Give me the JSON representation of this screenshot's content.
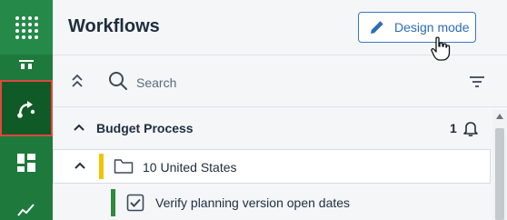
{
  "app": {
    "title": "Workflows",
    "accent_color": "#1e7a3c",
    "active_marker_color": "#e0473e"
  },
  "rail": {
    "items": [
      {
        "icon": "app-grid-icon"
      },
      {
        "icon": "rail-item-icon"
      },
      {
        "icon": "workflow-icon",
        "active": true
      },
      {
        "icon": "dashboard-icon"
      },
      {
        "icon": "analytics-icon"
      }
    ]
  },
  "header": {
    "design_mode_label": "Design mode",
    "design_mode_icon": "pencil-icon"
  },
  "toolbar": {
    "collapse_icon": "collapse-all-icon",
    "search_placeholder": "Search",
    "filter_icon": "filter-icon"
  },
  "group": {
    "title": "Budget Process",
    "notification_count": "1",
    "expanded": true
  },
  "folder": {
    "label": "10 United States",
    "status_color": "#f2c400",
    "expanded": true
  },
  "task": {
    "label": "Verify planning version open dates",
    "status_color": "#2e8b3d",
    "checked": true
  }
}
